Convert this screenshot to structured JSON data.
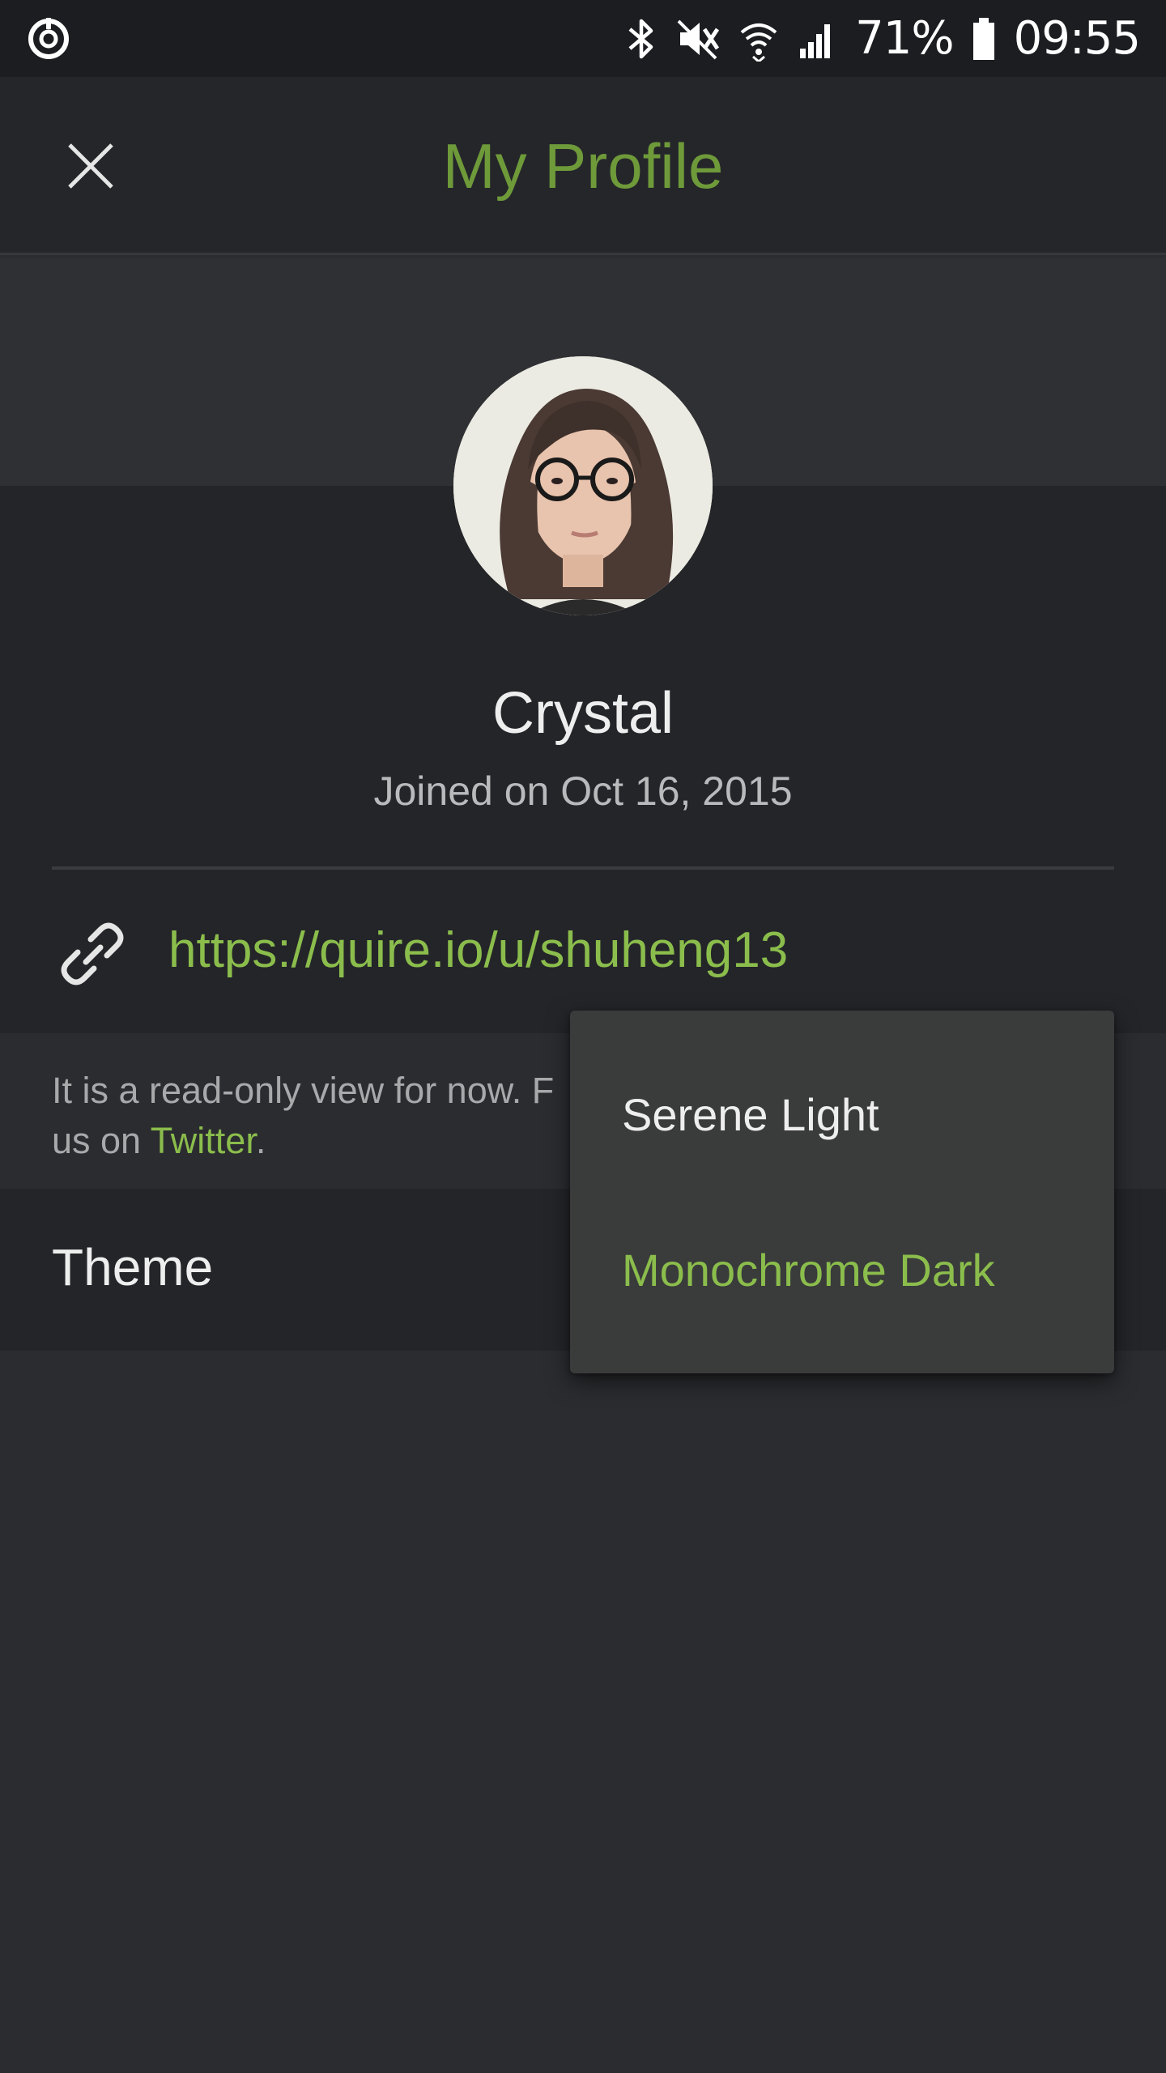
{
  "status_bar": {
    "battery": "71%",
    "time": "09:55",
    "icons": [
      "sync-icon",
      "bluetooth-icon",
      "mute-icon",
      "wifi-icon",
      "signal-icon",
      "battery-icon"
    ]
  },
  "header": {
    "title": "My Profile",
    "close_icon": "close-icon"
  },
  "profile": {
    "name": "Crystal",
    "joined": "Joined on Oct 16, 2015",
    "url": "https://quire.io/u/shuheng13",
    "link_icon": "link-icon"
  },
  "notice": {
    "text_part1": "It is a read-only view for now. F",
    "text_part2": "us on ",
    "twitter_label": "Twitter",
    "text_part3": "."
  },
  "theme": {
    "label": "Theme",
    "options": [
      "Serene Light",
      "Monochrome Dark"
    ],
    "selected": "Monochrome Dark"
  },
  "colors": {
    "accent": "#8bbd4c",
    "title_green": "#6e9a3a",
    "background": "#2b2c30",
    "card": "#242529",
    "menu": "#3a3b3b"
  }
}
